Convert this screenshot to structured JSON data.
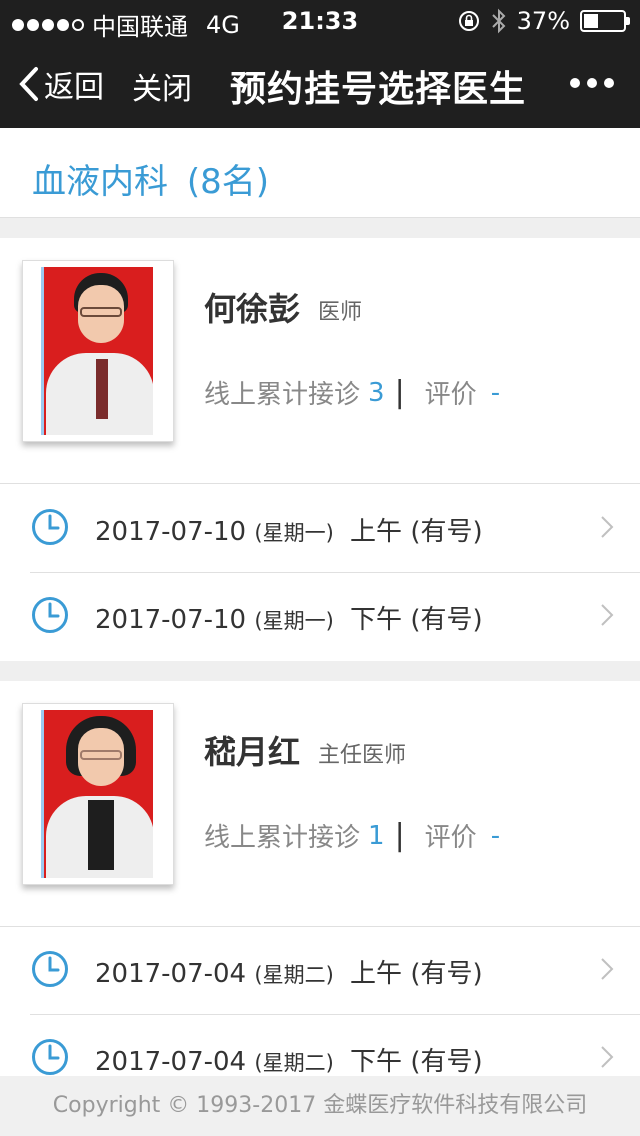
{
  "status_bar": {
    "carrier": "中国联通",
    "network": "4G",
    "time": "21:33",
    "battery": "37%",
    "battery_level": 0.37
  },
  "nav": {
    "back_label": "返回",
    "close_label": "关闭",
    "title": "预约挂号选择医生"
  },
  "department": {
    "label": "血液内科",
    "count": "(8名)"
  },
  "doctors": [
    {
      "name": "何徐彭",
      "title": "医师",
      "stats_label": "线上累计接诊",
      "visits": "3",
      "rating_label": "评价",
      "rating": "-",
      "slots": [
        {
          "date": "2017-07-10",
          "weekday": "(星期一)",
          "period": "上午",
          "status": "(有号)"
        },
        {
          "date": "2017-07-10",
          "weekday": "(星期一)",
          "period": "下午",
          "status": "(有号)"
        }
      ]
    },
    {
      "name": "嵇月红",
      "title": "主任医师",
      "stats_label": "线上累计接诊",
      "visits": "1",
      "rating_label": "评价",
      "rating": "-",
      "slots": [
        {
          "date": "2017-07-04",
          "weekday": "(星期二)",
          "period": "上午",
          "status": "(有号)"
        },
        {
          "date": "2017-07-04",
          "weekday": "(星期二)",
          "period": "下午",
          "status": "(有号)"
        }
      ]
    }
  ],
  "footer": {
    "copyright": "Copyright © 1993-2017 金蝶医疗软件科技有限公司"
  },
  "colors": {
    "accent": "#3a9bd5",
    "bar": "#1f1f1f"
  }
}
